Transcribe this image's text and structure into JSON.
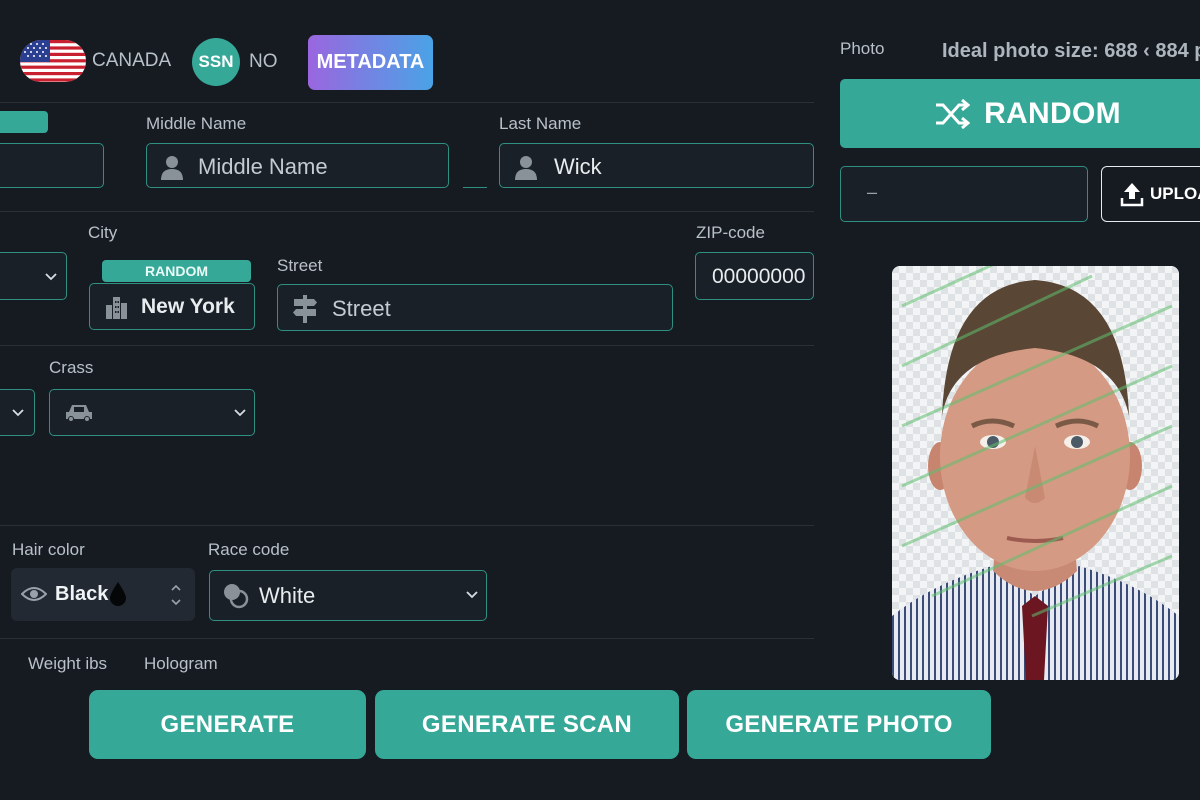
{
  "top_bar": {
    "country_label": "CANADA",
    "ssn_badge": "SSN",
    "ssn_value": "NO",
    "metadata_button": "METADATA"
  },
  "photo_panel": {
    "label": "Photo",
    "ideal_size": "Ideal photo size: 688 ‹ 884 p",
    "random_button": "RANDOM",
    "file_input_value": "–",
    "upload_button": "UPLOA"
  },
  "name_row": {
    "first_random_label": "",
    "middle_label": "Middle Name",
    "middle_placeholder": "Middle Name",
    "last_label": "Last Name",
    "last_value": "Wick"
  },
  "address_row": {
    "city_label": "City",
    "city_random": "RANDOM",
    "city_value": "New York",
    "street_label": "Street",
    "street_placeholder": "Street",
    "zip_label": "ZIP-code",
    "zip_value": "00000000"
  },
  "class_row": {
    "class_label": "Crass"
  },
  "appearance_row": {
    "hair_label": "Hair color",
    "hair_value": "Black",
    "race_label": "Race code",
    "race_value": "White"
  },
  "bottom_labels": {
    "weight_label": "Weight ibs",
    "hologram_label": "Hologram"
  },
  "actions": {
    "generate": "GENERATE",
    "generate_scan": "GENERATE SCAN",
    "generate_photo": "GENERATE PHOTO"
  },
  "colors": {
    "accent": "#35a898",
    "background": "#161b22",
    "metadata_gradient": [
      "#8f6ae0",
      "#4aa0e8"
    ]
  }
}
